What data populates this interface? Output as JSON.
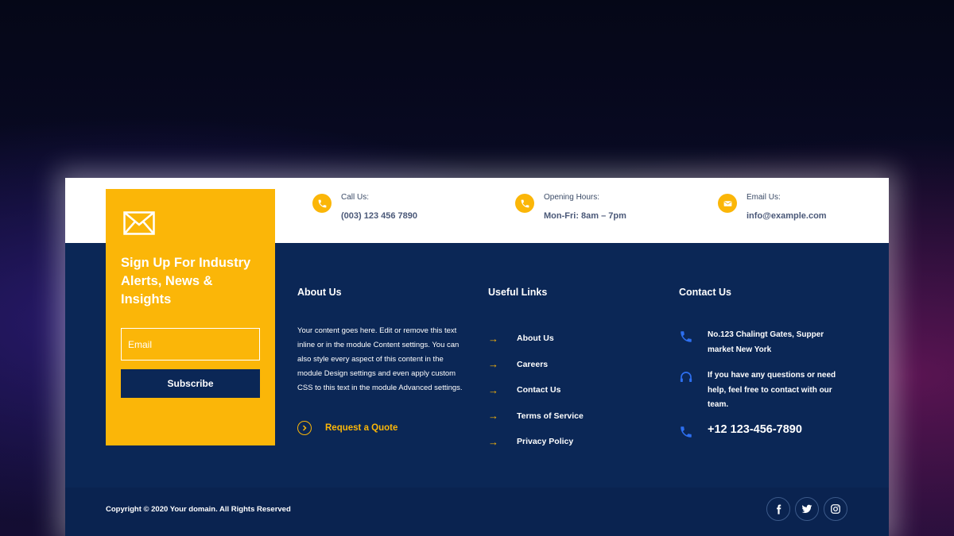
{
  "top_strip": {
    "items": [
      {
        "icon": "phone-icon",
        "label": "Call Us:",
        "value": "(003) 123 456 7890"
      },
      {
        "icon": "phone-icon",
        "label": "Opening Hours:",
        "value": "Mon-Fri: 8am – 7pm"
      },
      {
        "icon": "envelope-icon",
        "label": "Email Us:",
        "value": "info@example.com"
      }
    ]
  },
  "signup": {
    "title": "Sign Up For Industry Alerts, News & Insights",
    "email_placeholder": "Email",
    "subscribe_label": "Subscribe"
  },
  "about": {
    "title": "About Us",
    "text": "Your content goes here. Edit or remove this text inline or in the module Content settings. You can also style every aspect of this content in the module Design settings and even apply custom CSS to this text in the module Advanced settings.",
    "quote_label": "Request a Quote"
  },
  "useful_links": {
    "title": "Useful Links",
    "items": [
      "About Us",
      "Careers",
      "Contact Us",
      "Terms of Service",
      "Privacy Policy"
    ]
  },
  "contact": {
    "title": "Contact Us",
    "address": "No.123 Chalingt Gates, Supper market New York",
    "help_text": "If you have any questions or need help, feel free to contact with our team.",
    "phone": "+12 123-456-7890"
  },
  "bottom": {
    "copyright": "Copyright © 2020 Your domain. All Rights Reserved",
    "social": [
      {
        "icon": "facebook-icon",
        "glyph": "f"
      },
      {
        "icon": "twitter-icon",
        "glyph": "t"
      },
      {
        "icon": "instagram-icon",
        "glyph": "ig"
      }
    ]
  },
  "colors": {
    "accent": "#fbb608",
    "navy": "#0b2756",
    "white": "#ffffff",
    "link_icon_blue": "#2d6ff0"
  }
}
